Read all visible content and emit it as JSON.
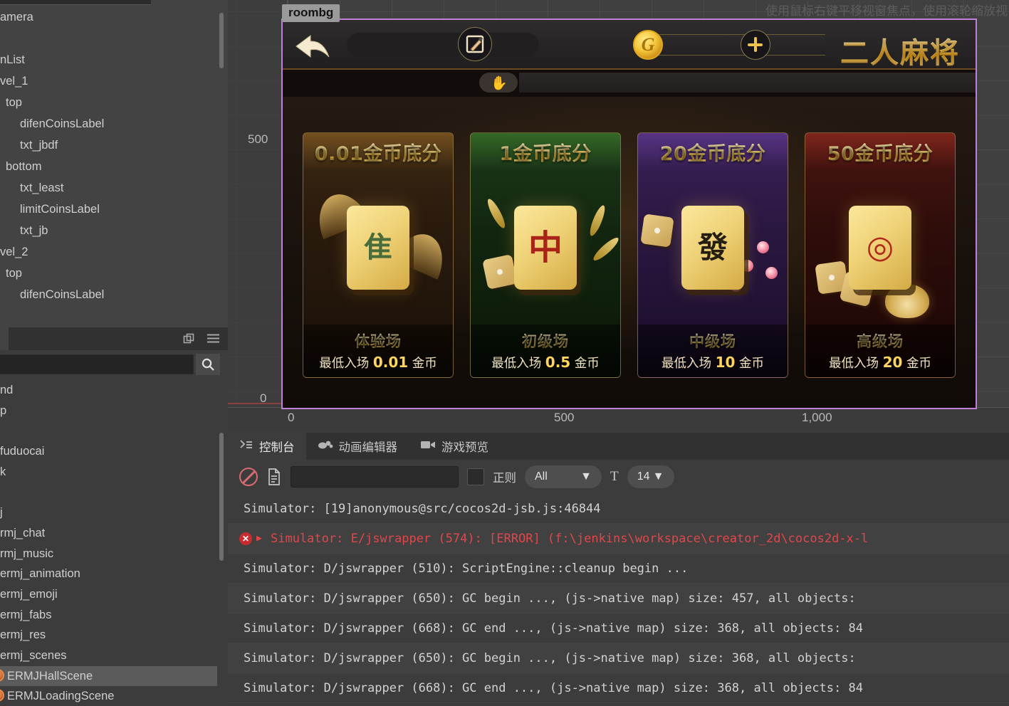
{
  "hierarchy": {
    "items": [
      {
        "label": "amera",
        "depth": 0
      },
      {
        "label": "",
        "depth": 0
      },
      {
        "label": "nList",
        "depth": 0
      },
      {
        "label": "vel_1",
        "depth": 0
      },
      {
        "label": "top",
        "depth": 1
      },
      {
        "label": "difenCoinsLabel",
        "depth": 2
      },
      {
        "label": "txt_jbdf",
        "depth": 2
      },
      {
        "label": "bottom",
        "depth": 1
      },
      {
        "label": "txt_least",
        "depth": 2
      },
      {
        "label": "limitCoinsLabel",
        "depth": 2
      },
      {
        "label": "txt_jb",
        "depth": 2
      },
      {
        "label": "vel_2",
        "depth": 0
      },
      {
        "label": "top",
        "depth": 1
      },
      {
        "label": "difenCoinsLabel",
        "depth": 2
      }
    ]
  },
  "assets": {
    "search_placeholder": "",
    "search_value": "",
    "search_icon": "search-icon",
    "duplicate_icon": "duplicate-icon",
    "menu_icon": "hamburger-menu-icon",
    "items": [
      {
        "label": "nd",
        "selected": false,
        "scene": false
      },
      {
        "label": "p",
        "selected": false,
        "scene": false
      },
      {
        "label": "",
        "selected": false,
        "scene": false
      },
      {
        "label": "fuduocai",
        "selected": false,
        "scene": false
      },
      {
        "label": "k",
        "selected": false,
        "scene": false
      },
      {
        "label": "",
        "selected": false,
        "scene": false
      },
      {
        "label": "j",
        "selected": false,
        "scene": false
      },
      {
        "label": "rmj_chat",
        "selected": false,
        "scene": false
      },
      {
        "label": "rmj_music",
        "selected": false,
        "scene": false
      },
      {
        "label": "ermj_animation",
        "selected": false,
        "scene": false
      },
      {
        "label": "ermj_emoji",
        "selected": false,
        "scene": false
      },
      {
        "label": "ermj_fabs",
        "selected": false,
        "scene": false
      },
      {
        "label": "ermj_res",
        "selected": false,
        "scene": false
      },
      {
        "label": "ermj_scenes",
        "selected": false,
        "scene": false
      },
      {
        "label": "ERMJHallScene",
        "selected": true,
        "scene": true
      },
      {
        "label": "ERMJLoadingScene",
        "selected": false,
        "scene": true
      }
    ]
  },
  "scene": {
    "node_tag": "roombg",
    "hint": "使用鼠标右键平移视窗焦点，使用滚轮缩放视",
    "ruler_v": [
      "500",
      "0"
    ],
    "ruler_h": [
      "0",
      "500",
      "1,000"
    ],
    "selection_color": "#c07fd8"
  },
  "game": {
    "title": "二人麻将",
    "back_icon": "back-arrow-icon",
    "edit_icon": "edit-pencil-icon",
    "coin_icon": "gold-coin-icon",
    "coin_glyph": "G",
    "plus_icon": "plus-icon",
    "hand_icon": "hand-pointer-icon",
    "rooms": [
      {
        "title": "0.01金币底分",
        "level": "体验场",
        "min_prefix": "最低入场",
        "min_value": "0.01",
        "min_suffix": "金币",
        "tile_glyph": "隹",
        "theme": 0,
        "accent": "#c8912f"
      },
      {
        "title": "1金币底分",
        "level": "初级场",
        "min_prefix": "最低入场",
        "min_value": "0.5",
        "min_suffix": "金币",
        "tile_glyph": "中",
        "theme": 1,
        "accent": "#4e9b36"
      },
      {
        "title": "20金币底分",
        "level": "中级场",
        "min_prefix": "最低入场",
        "min_value": "10",
        "min_suffix": "金币",
        "tile_glyph": "發",
        "theme": 2,
        "accent": "#8350c8"
      },
      {
        "title": "50金币底分",
        "level": "高级场",
        "min_prefix": "最低入场",
        "min_value": "20",
        "min_suffix": "金币",
        "tile_glyph": "◎",
        "theme": 3,
        "accent": "#c0392b"
      }
    ]
  },
  "console": {
    "tabs": [
      {
        "label": "控制台",
        "icon": "console-icon",
        "active": true
      },
      {
        "label": "动画编辑器",
        "icon": "animation-icon",
        "active": false
      },
      {
        "label": "游戏预览",
        "icon": "camera-icon",
        "active": false
      }
    ],
    "toolbar": {
      "clear_icon": "clear-icon",
      "file_icon": "file-icon",
      "filter_value": "",
      "filter_placeholder": "",
      "regex_label": "正则",
      "level_value": "All",
      "font_icon": "font-size-icon",
      "size_value": "14"
    },
    "logs": [
      {
        "text": "Simulator: [19]anonymous@src/cocos2d-jsb.js:46844",
        "type": "info"
      },
      {
        "text": "Simulator: E/jswrapper (574): [ERROR] (f:\\jenkins\\workspace\\creator_2d\\cocos2d-x-l",
        "type": "error"
      },
      {
        "text": "Simulator: D/jswrapper (510): ScriptEngine::cleanup begin ...",
        "type": "info"
      },
      {
        "text": "Simulator: D/jswrapper (650): GC begin ..., (js->native map) size: 457, all objects:",
        "type": "info"
      },
      {
        "text": "Simulator: D/jswrapper (668): GC end ..., (js->native map) size: 368, all objects: 84",
        "type": "info"
      },
      {
        "text": "Simulator: D/jswrapper (650): GC begin ..., (js->native map) size: 368, all objects:",
        "type": "info"
      },
      {
        "text": "Simulator: D/jswrapper (668): GC end ..., (js->native map) size: 368, all objects: 84",
        "type": "info"
      }
    ]
  }
}
